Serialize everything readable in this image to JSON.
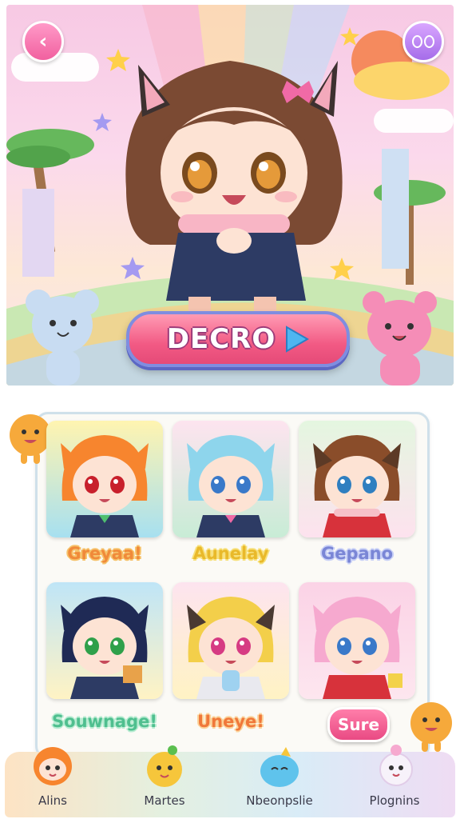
{
  "hero": {
    "primary_button_label": "DECRO"
  },
  "gallery": {
    "characters": [
      {
        "name": "Greyaa!",
        "label_color": "#f08a3a",
        "stroke": "#f6c26a"
      },
      {
        "name": "Aunelay",
        "label_color": "#e9b92a",
        "stroke": "#f7e07a"
      },
      {
        "name": "Gepano",
        "label_color": "#7a86d6",
        "stroke": "#c9d1f7"
      },
      {
        "name": "Souwnage!",
        "label_color": "#4fbf8f",
        "stroke": "#b8ecd2"
      },
      {
        "name": "Uneye!",
        "label_color": "#f0783a",
        "stroke": "#fbd39a"
      }
    ],
    "confirm_button_label": "Sure"
  },
  "nav": {
    "items": [
      {
        "label": "Alins"
      },
      {
        "label": "Martes"
      },
      {
        "label": "Nbeonpslie"
      },
      {
        "label": "Plognins"
      }
    ]
  },
  "colors": {
    "accent_pink": "#f25a84",
    "accent_purple": "#a56ce9",
    "frame_blue": "#7f8de0"
  }
}
